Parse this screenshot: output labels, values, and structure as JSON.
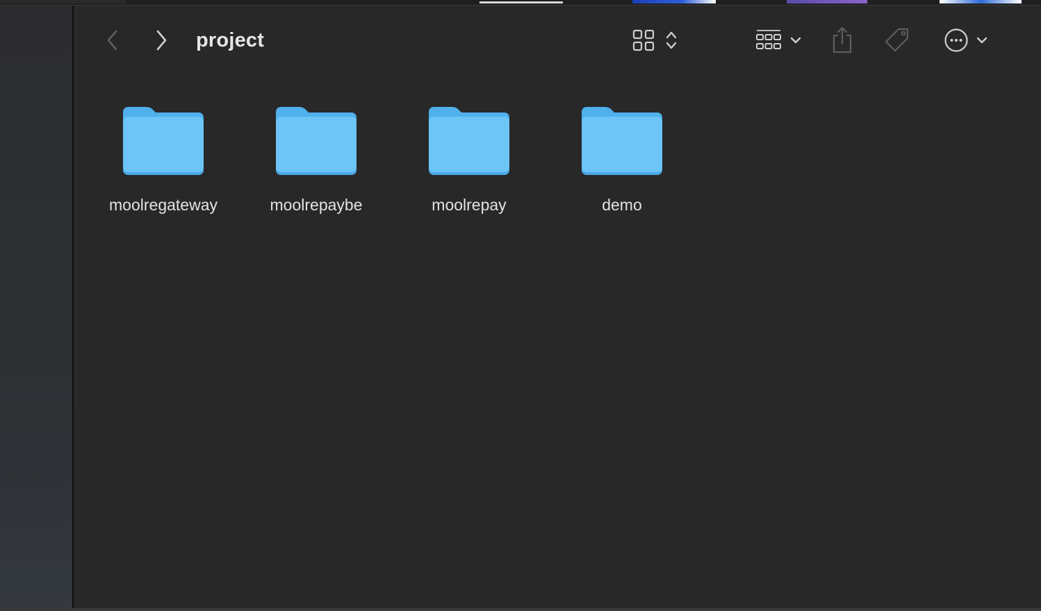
{
  "window": {
    "title": "project"
  },
  "toolbar": {
    "icons": {
      "back": "chevron-left-icon",
      "forward": "chevron-right-icon",
      "view": "icon-grid-view-icon",
      "group": "group-grid-icon",
      "share": "share-icon",
      "tag": "tag-icon",
      "more": "ellipsis-circle-icon"
    }
  },
  "folders": [
    {
      "name": "moolregateway"
    },
    {
      "name": "moolrepaybe"
    },
    {
      "name": "moolrepay"
    },
    {
      "name": "demo"
    }
  ],
  "colors": {
    "background": "#282828",
    "folder": "#6cc4f7",
    "folder_tab": "#4fb0ec",
    "text": "#e3e3e3",
    "icon_active": "#cfcfcf",
    "icon_disabled": "#5e5e5e"
  }
}
